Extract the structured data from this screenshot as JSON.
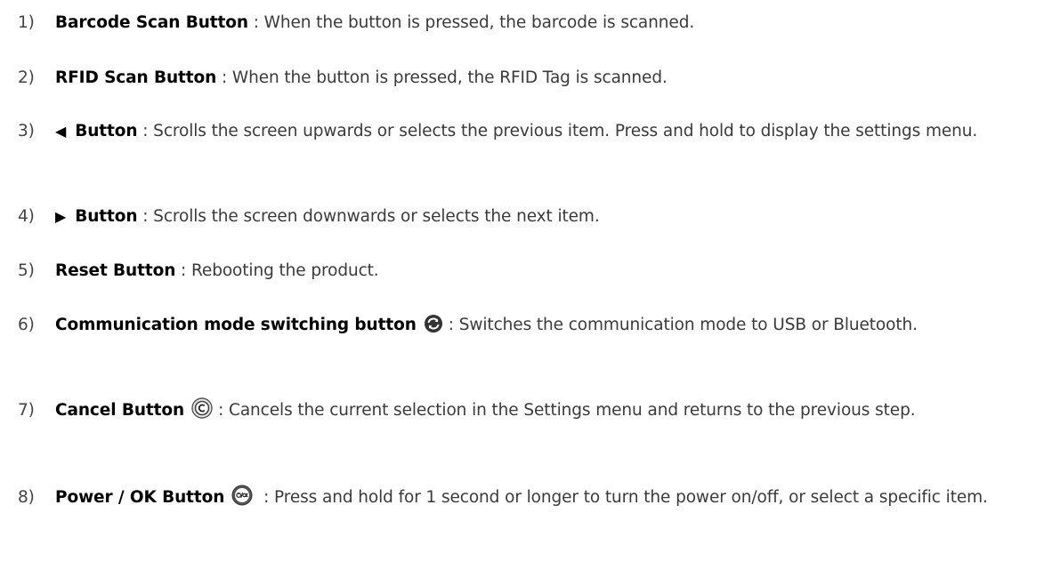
{
  "items": [
    {
      "number": "1)",
      "name": "Barcode Scan Button",
      "sep": " : ",
      "desc": "When the button is pressed, the barcode is scanned."
    },
    {
      "number": "2)",
      "name": "RFID Scan Button",
      "sep": " : ",
      "desc": "When the button is pressed, the RFID Tag is scanned."
    },
    {
      "number": "3)",
      "arrow": "◀",
      "name": "Button",
      "sep": " : ",
      "desc": "Scrolls the screen upwards or selects the previous item. Press and hold to display the settings menu."
    },
    {
      "number": "4)",
      "arrow": "▶",
      "name": "Button",
      "sep": " : ",
      "desc": "Scrolls the screen downwards or selects the next item."
    },
    {
      "number": "5)",
      "name": "Reset Button",
      "sep": " : ",
      "desc": "Rebooting the product."
    },
    {
      "number": "6)",
      "name": "Communication mode switching button",
      "icon": "sync-circle-icon",
      "sep": ": ",
      "desc": "Switches the communication mode to USB or Bluetooth."
    },
    {
      "number": "7)",
      "name": "Cancel Button",
      "icon": "cancel-c-circle-icon",
      "sep": ": ",
      "desc": "Cancels the current selection in the Settings menu and returns to the previous step."
    },
    {
      "number": "8)",
      "name": "Power / OK Button",
      "icon": "power-ok-circle-icon",
      "sep": " : ",
      "desc": "Press and hold for 1 second or longer to turn the power on/off, or select a specific item."
    }
  ]
}
